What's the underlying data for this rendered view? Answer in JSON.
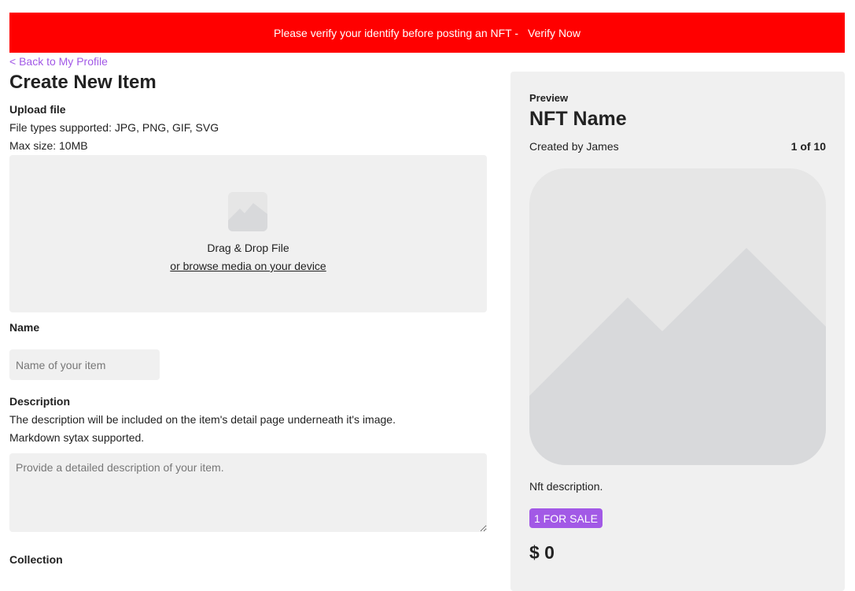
{
  "banner": {
    "message": "Please verify your identify before posting an NFT -",
    "verify_label": "Verify Now",
    "color": "#ff0000"
  },
  "nav": {
    "back_label": "< Back to My Profile"
  },
  "page": {
    "title": "Create New Item"
  },
  "upload": {
    "label": "Upload file",
    "types": "File types supported: JPG, PNG, GIF, SVG",
    "max_size": "Max size: 10MB",
    "drag_label": "Drag & Drop File",
    "browse_label": "or browse media on your device",
    "icon": "image-placeholder-icon"
  },
  "name": {
    "label": "Name",
    "placeholder": "Name of your item",
    "value": ""
  },
  "description": {
    "label": "Description",
    "help_line1": "The description will be included on the item's detail page underneath it's image.",
    "help_line2": "Markdown sytax supported.",
    "placeholder": "Provide a detailed description of your item.",
    "value": ""
  },
  "collection": {
    "label": "Collection"
  },
  "preview": {
    "label": "Preview",
    "nft_name": "NFT Name",
    "creator": "Created by James",
    "edition": "1 of 10",
    "description": "Nft description.",
    "sale_badge": "1 FOR SALE",
    "price": "$ 0",
    "image_icon": "image-placeholder-icon"
  },
  "colors": {
    "accent": "#a259e6",
    "panel": "#f0f0f0",
    "placeholder_bg": "#e6e6e6",
    "placeholder_shape": "#d8d9db"
  }
}
